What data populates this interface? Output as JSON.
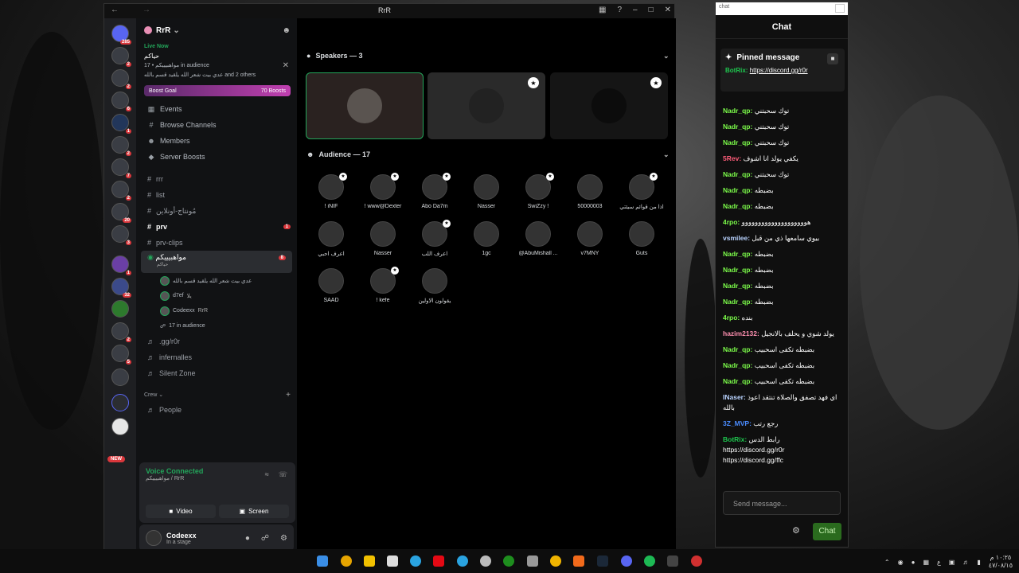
{
  "window": {
    "title": "RrR"
  },
  "guild_badges": [
    "285",
    "2",
    "2",
    "6",
    "1",
    "2",
    "7",
    "2",
    "20",
    "3",
    "1",
    "32",
    "2",
    "5"
  ],
  "new_label": "NEW",
  "sidebar": {
    "server_name": "RrR",
    "live_now": "Live Now",
    "live_channel": "حياكم",
    "live_meta": "مواهبيييكم • 17 in audience",
    "live_meta2": "عدي بيت شعر الله يلقيد قسم بالله and 2 others",
    "boost_label": "Boost Goal",
    "boost_count": "70 Boosts",
    "menu": [
      {
        "label": "Events",
        "icon": "calendar-icon"
      },
      {
        "label": "Browse Channels",
        "icon": "browse-icon"
      },
      {
        "label": "Members",
        "icon": "members-icon"
      },
      {
        "label": "Server Boosts",
        "icon": "boost-icon"
      }
    ],
    "channels": [
      {
        "label": "rrr",
        "bold": false
      },
      {
        "label": "list",
        "bold": false
      },
      {
        "label": "مُونتاج-أونلاين",
        "bold": false
      },
      {
        "label": "prv",
        "bold": true,
        "count": "1"
      },
      {
        "label": "prv-clips",
        "bold": false
      }
    ],
    "active_channel": "مواهبيييكم",
    "active_sub": "حياكم",
    "active_count": "8",
    "voice_members": [
      {
        "name": "عدي بيت شعر الله يلقيد قسم بالله"
      },
      {
        "name": "d7ef"
      },
      {
        "name": "Codeexx"
      }
    ],
    "voice_member_tags": [
      "",
      "يلا",
      "RrR"
    ],
    "audience_count": "17 in audience",
    "channels2": [
      ".gg/r0r",
      "infernalles",
      "Silent Zone"
    ],
    "category": "Crew",
    "category_channel": "People"
  },
  "voice_panel": {
    "status": "Voice Connected",
    "location": "مواهبيييكم / RrR",
    "video": "Video",
    "screen": "Screen"
  },
  "user_panel": {
    "name": "Codeexx",
    "status": "In a stage"
  },
  "stage": {
    "speakers_label": "Speakers — 3",
    "audience_label": "Audience — 17",
    "audience": [
      "! iNIF",
      "! www@Dexter",
      "Abo Da7m",
      "Nasser",
      "SwiZzy !",
      "50000003",
      "اذا من قوائم سيئتي",
      "اعرف احبي",
      "Nasser",
      "اعرف اللب",
      "1gc",
      "@AbuMishall ...",
      "v7MNY",
      "Guts",
      "SAAD",
      "! kefe",
      "يقولون الاولين"
    ]
  },
  "chat": {
    "window_label": "chat",
    "title": "Chat",
    "pinned_title": "Pinned message",
    "pinned_author": "BotRix:",
    "pinned_link": "https://discord.gg/r0r",
    "messages": [
      {
        "author": "Nadr_qp:",
        "text": "توك سحبتني",
        "color": "#7cfc4a"
      },
      {
        "author": "Nadr_qp:",
        "text": "توك سحبتني",
        "color": "#7cfc4a"
      },
      {
        "author": "Nadr_qp:",
        "text": "توك سحبتني",
        "color": "#7cfc4a"
      },
      {
        "author": "5Rev:",
        "text": "يكفي يولد انا اشوف",
        "color": "#ff5d7a"
      },
      {
        "author": "Nadr_qp:",
        "text": "توك سحبتني",
        "color": "#7cfc4a"
      },
      {
        "author": "Nadr_qp:",
        "text": "بضبطه",
        "color": "#7cfc4a"
      },
      {
        "author": "Nadr_qp:",
        "text": "بضبطه",
        "color": "#7cfc4a"
      },
      {
        "author": "4rpo:",
        "text": "هوووووووووووووووووووو",
        "color": "#7cfc4a"
      },
      {
        "author": "vsmilee:",
        "text": "بيوي سامعها ذي من قبل",
        "color": "#b9d3ff"
      },
      {
        "author": "Nadr_qp:",
        "text": "بضبطه",
        "color": "#7cfc4a"
      },
      {
        "author": "Nadr_qp:",
        "text": "بضبطه",
        "color": "#7cfc4a"
      },
      {
        "author": "Nadr_qp:",
        "text": "بضبطه",
        "color": "#7cfc4a"
      },
      {
        "author": "Nadr_qp:",
        "text": "بضبطه",
        "color": "#7cfc4a"
      },
      {
        "author": "4rpo:",
        "text": "بنده",
        "color": "#7cfc4a"
      },
      {
        "author": "hazim2132:",
        "text": "يولد شوي و يحلف بالانجيل",
        "color": "#ff8fb0"
      },
      {
        "author": "Nadr_qp:",
        "text": "بضبطه تكفى اسحبيب",
        "color": "#7cfc4a"
      },
      {
        "author": "Nadr_qp:",
        "text": "بضبطه تكفى اسحبيب",
        "color": "#7cfc4a"
      },
      {
        "author": "Nadr_qp:",
        "text": "بضبطه تكفى اسحبيب",
        "color": "#7cfc4a"
      },
      {
        "author": "INaser:",
        "text": "اي فهد تصفق والصلاة تنتقد اعوذ بالله",
        "color": "#b9d3ff"
      },
      {
        "author": "3Z_MVP:",
        "text": "رجع رتب",
        "color": "#4a8cff"
      },
      {
        "author": "BotRix:",
        "text": "رابط الدس https://discord.gg/r0r https://discord.gg/ffc",
        "color": "#1ec84f"
      }
    ],
    "input_placeholder": "Send message...",
    "send_label": "Chat"
  },
  "taskbar": {
    "time": "١٠:٢٥ م",
    "date": "٤٧/٠٨/١٥",
    "lang": "ع"
  }
}
